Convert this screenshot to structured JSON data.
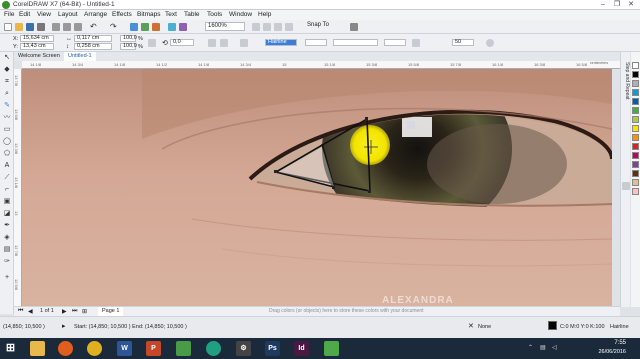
{
  "window": {
    "title": "CorelDRAW X7 (64-Bit) - Untitled-1",
    "controls": [
      "–",
      "❐",
      "✕"
    ]
  },
  "menu": [
    "File",
    "Edit",
    "View",
    "Layout",
    "Arrange",
    "Effects",
    "Bitmaps",
    "Text",
    "Table",
    "Tools",
    "Window",
    "Help"
  ],
  "standard_toolbar": {
    "zoom": "1600%",
    "snap_to": "Snap To"
  },
  "property_bar": {
    "x_label": "X:",
    "x_value": "15,634 cm",
    "y_label": "Y:",
    "y_value": "13,43 cm",
    "width_value": "0,117 cm",
    "height_value": "0,258 cm",
    "scale_x": "100,0",
    "scale_y": "100,0",
    "pct": "%",
    "rotation": "0,0",
    "outline_width": "Hairline",
    "size_value": "50"
  },
  "tabs": [
    "Welcome Screen",
    "Untitled-1"
  ],
  "ruler": {
    "h_ticks": [
      "14 1/8",
      "14 3/4",
      "14 1/8",
      "14 1/2",
      "14 1/8",
      "14 3/4",
      "15",
      "15 1/8",
      "15 3/8",
      "15 5/8",
      "15 7/8",
      "16 1/8",
      "16 3/8",
      "16 5/8"
    ],
    "unit": "centimeters",
    "v_ticks": [
      "13 7/8",
      "13 5/8",
      "13 3/8",
      "13 1/8",
      "13",
      "12 7/8",
      "12 5/8"
    ]
  },
  "page_nav": {
    "counter": "1 of 1",
    "page_tab": "Page 1",
    "drag_tip": "Drag colors (or objects) here to store these colors with your document"
  },
  "status": {
    "cursor": "(14,850; 10,500 )",
    "node_info": "Start: (14,850; 10,500 )  End: (14,850; 10,500 )",
    "fill": "None",
    "color_info": "C:0 M:0 Y:0 K:100",
    "outline": "Hairline"
  },
  "dock": {
    "label": "Step and Repeat"
  },
  "taskbar": {
    "time": "7:55",
    "date": "26/06/2016"
  },
  "palette_colors": [
    "#ffffff",
    "#000000",
    "#b0b0b0",
    "#00a0e0",
    "#0060b0",
    "#40b040",
    "#a0d040",
    "#ffe000",
    "#ff9000",
    "#e02020",
    "#c00060",
    "#8040a0",
    "#603010",
    "#e0c090",
    "#ffc0c0"
  ],
  "colors": {
    "highlight": "#f5e600",
    "skin": "#c99b86",
    "accent": "#3a8f2c"
  },
  "watermark_text": "ALEXANDRA"
}
